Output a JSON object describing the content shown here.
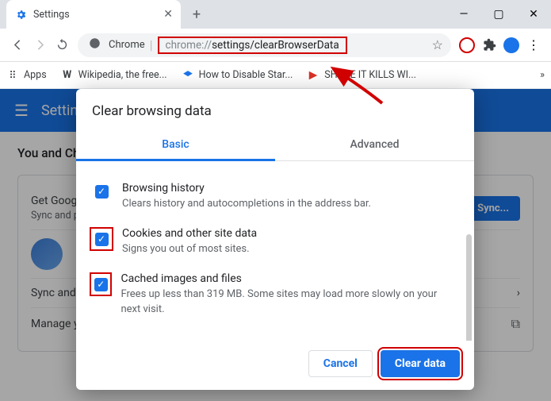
{
  "tab": {
    "title": "Settings"
  },
  "url": {
    "scheme": "chrome://",
    "path": "settings/clearBrowserData",
    "label": "Chrome"
  },
  "bookmarks": {
    "apps": "Apps",
    "wiki": "Wikipedia, the free...",
    "howto": "How to Disable Star...",
    "share": "SHARE IT KILLS WI..."
  },
  "settings": {
    "header": "Settings",
    "section": "You and Chrome",
    "card1a": "Get Google smarts in Chrome",
    "card1b": "Sync and personalize",
    "syncbtn": "Sync...",
    "row2": "Sync and Google services",
    "row3": "Manage your Google Account"
  },
  "dialog": {
    "title": "Clear browsing data",
    "tab_basic": "Basic",
    "tab_advanced": "Advanced",
    "opt1_t": "Browsing history",
    "opt1_s": "Clears history and autocompletions in the address bar.",
    "opt2_t": "Cookies and other site data",
    "opt2_s": "Signs you out of most sites.",
    "opt3_t": "Cached images and files",
    "opt3_s": "Frees up less than 319 MB. Some sites may load more slowly on your next visit.",
    "cancel": "Cancel",
    "clear": "Clear data"
  }
}
